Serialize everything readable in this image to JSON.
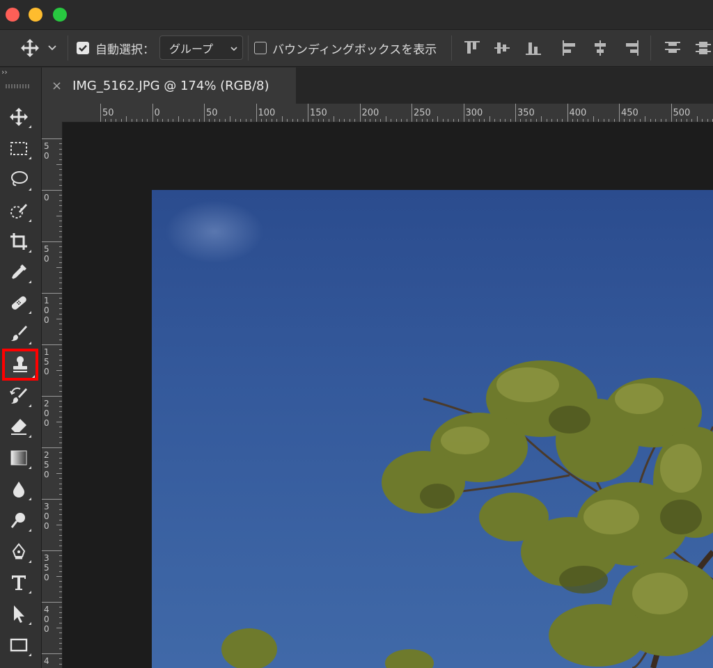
{
  "window": {
    "traffic_lights": [
      {
        "name": "close",
        "color": "#fe5f57"
      },
      {
        "name": "minimize",
        "color": "#febc2e"
      },
      {
        "name": "zoom",
        "color": "#28c840"
      }
    ]
  },
  "options_bar": {
    "auto_select_label": "自動選択：",
    "auto_select_checked": true,
    "target_dropdown_value": "グループ",
    "bounding_box_label": "バウンディングボックスを表示",
    "bounding_box_checked": false
  },
  "tools": [
    {
      "name": "move-tool",
      "icon": "move-icon"
    },
    {
      "name": "marquee-tool",
      "icon": "marquee-icon"
    },
    {
      "name": "lasso-tool",
      "icon": "lasso-icon"
    },
    {
      "name": "quick-selection-tool",
      "icon": "quick-selection-icon"
    },
    {
      "name": "crop-tool",
      "icon": "crop-icon"
    },
    {
      "name": "eyedropper-tool",
      "icon": "eyedropper-icon"
    },
    {
      "name": "healing-brush-tool",
      "icon": "bandage-icon"
    },
    {
      "name": "brush-tool",
      "icon": "brush-icon"
    },
    {
      "name": "clone-stamp-tool",
      "icon": "stamp-icon",
      "selected": true
    },
    {
      "name": "history-brush-tool",
      "icon": "history-brush-icon"
    },
    {
      "name": "eraser-tool",
      "icon": "eraser-icon"
    },
    {
      "name": "gradient-tool",
      "icon": "gradient-icon"
    },
    {
      "name": "blur-tool",
      "icon": "drop-icon"
    },
    {
      "name": "dodge-tool",
      "icon": "dodge-icon"
    },
    {
      "name": "pen-tool",
      "icon": "pen-icon"
    },
    {
      "name": "type-tool",
      "icon": "type-icon"
    },
    {
      "name": "path-selection-tool",
      "icon": "arrow-icon"
    },
    {
      "name": "rectangle-tool",
      "icon": "rectangle-icon"
    }
  ],
  "panel_toggle": "››",
  "document_tab": {
    "close_glyph": "×",
    "title": "IMG_5162.JPG @ 174% (RGB/8)"
  },
  "ruler_top_labels": [
    "50",
    "0",
    "50",
    "100",
    "150",
    "200",
    "250",
    "300",
    "350",
    "400",
    "450",
    "500"
  ],
  "ruler_left_labels": [
    "50",
    "0",
    "50",
    "100",
    "150",
    "200",
    "250",
    "300",
    "350",
    "400",
    "4"
  ],
  "colors": {
    "selection_highlight": "#ff0000",
    "sky": "#34599b",
    "foliage": "#6e7a2c"
  }
}
